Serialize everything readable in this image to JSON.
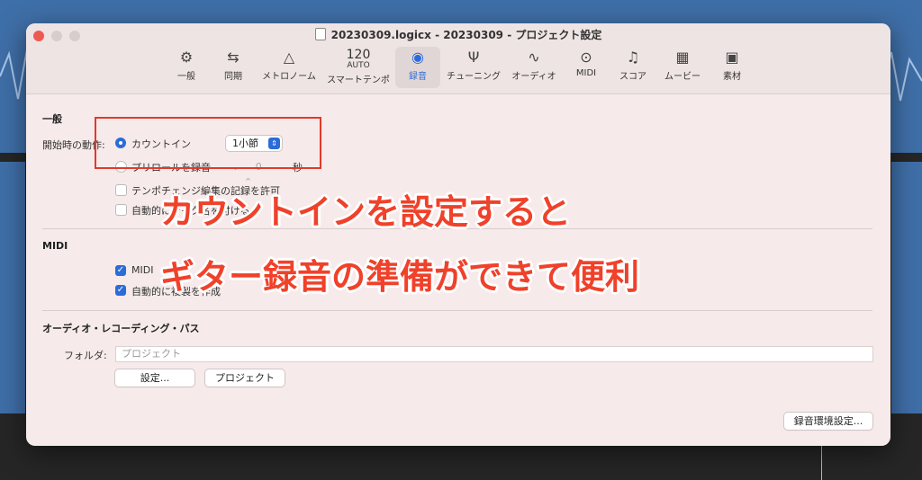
{
  "window": {
    "title": "20230309.logicx - 20230309 - プロジェクト設定"
  },
  "toolbar": {
    "items": [
      {
        "icon": "gear-icon",
        "label": "一般"
      },
      {
        "icon": "sync-icon",
        "label": "同期"
      },
      {
        "icon": "metronome-icon",
        "label": "メトロノーム"
      },
      {
        "icon": "tempo-icon",
        "value": "120",
        "sub": "AUTO",
        "label": "スマートテンポ"
      },
      {
        "icon": "record-icon",
        "label": "録音",
        "active": true
      },
      {
        "icon": "tuning-fork-icon",
        "label": "チューニング"
      },
      {
        "icon": "waveform-icon",
        "label": "オーディオ"
      },
      {
        "icon": "midi-icon",
        "label": "MIDI"
      },
      {
        "icon": "notes-icon",
        "label": "スコア"
      },
      {
        "icon": "film-icon",
        "label": "ムービー"
      },
      {
        "icon": "briefcase-icon",
        "label": "素材"
      }
    ]
  },
  "general": {
    "heading": "一般",
    "start_action_label": "開始時の動作:",
    "count_in_label": "カウントイン",
    "count_in_value": "1小節",
    "preroll_label": "プリロールを録音",
    "preroll_unit": "秒",
    "preroll_value": "0",
    "tempo_change_label": "テンポチェンジ編集の記録を許可",
    "auto_label": "自動的にテイク名を付ける"
  },
  "midi": {
    "heading": "MIDI",
    "midi_label": "MIDI",
    "auto_label": "自動的に複製を作成"
  },
  "audio_path": {
    "heading": "オーディオ・レコーディング・パス",
    "folder_label": "フォルダ:",
    "folder_placeholder": "プロジェクト",
    "set_button": "設定...",
    "project_button": "プロジェクト"
  },
  "footer": {
    "prefs_button": "録音環境設定..."
  },
  "overlay": {
    "line1": "カウントインを設定すると",
    "line2": "ギター録音の準備ができて便利"
  },
  "colors": {
    "accent": "#2c6cd9",
    "caption": "#f0412a",
    "highlight_box": "#e23a2a"
  }
}
